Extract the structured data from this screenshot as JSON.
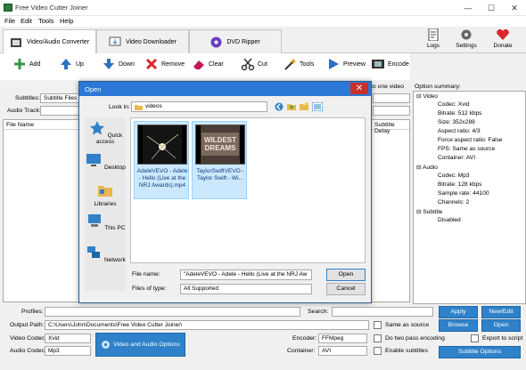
{
  "window": {
    "title": "Free Video Cutter Joiner",
    "minimize": "—",
    "maximize": "☐",
    "close": "✕"
  },
  "menu": [
    "File",
    "Edit",
    "Tools",
    "Help"
  ],
  "tabs": [
    {
      "label": "Video/Audio Converter",
      "active": true
    },
    {
      "label": "Video Downloader",
      "active": false
    },
    {
      "label": "DVD Ripper",
      "active": false
    }
  ],
  "top_buttons": [
    {
      "label": "Logs",
      "icon": "document-icon"
    },
    {
      "label": "Settings",
      "icon": "gear-icon"
    },
    {
      "label": "Donate",
      "icon": "heart-icon"
    }
  ],
  "toolbar": [
    {
      "label": "Add",
      "icon": "plus-icon"
    },
    {
      "label": "Up",
      "icon": "arrow-up-icon"
    },
    {
      "label": "Down",
      "icon": "arrow-down-icon"
    },
    {
      "label": "Remove",
      "icon": "x-icon"
    },
    {
      "label": "Clear",
      "icon": "eraser-icon"
    },
    {
      "label": "Cut",
      "icon": "scissors-icon"
    },
    {
      "label": "Tools",
      "icon": "wand-icon"
    },
    {
      "label": "Preview",
      "icon": "play-icon"
    },
    {
      "label": "Encode",
      "icon": "film-icon"
    }
  ],
  "merge_label": "to one video",
  "subtitles": {
    "label": "Subtitles:",
    "value": "Subtitle Files"
  },
  "audio_track": {
    "label": "Audio Track:"
  },
  "file_table": {
    "col_name": "File Name",
    "col_subtitle_delay": "Subtitle Delay"
  },
  "option_summary": {
    "title": "Option summary:",
    "video_header": "Video",
    "video": [
      "Codec: Xvid",
      "Bitrate: 512 kbps",
      "Size: 352x288",
      "Aspect ratio: 4/3",
      "Force aspect ratio: False",
      "FPS: Same as source",
      "Container: AVI"
    ],
    "audio_header": "Audio",
    "audio": [
      "Codec: Mp3",
      "Bitrate: 128 kbps",
      "Sample rate: 44100",
      "Channels: 2"
    ],
    "subtitle_header": "Subtitle",
    "subtitle": [
      "Disabled"
    ]
  },
  "bottom": {
    "profiles_label": "Profiles:",
    "search_label": "Search:",
    "output_path_label": "Output Path:",
    "output_path_value": "C:\\Users\\John\\Documents\\Free Video Cutter Joiner\\",
    "same_as_source": "Same as source",
    "video_codec_label": "Video Codec:",
    "video_codec_value": "Xvid",
    "audio_codec_label": "Audio Codec:",
    "audio_codec_value": "Mp3",
    "video_audio_options": "Video and Audio Options",
    "encoder_label": "Encoder:",
    "encoder_value": "FFMpeg",
    "container_label": "Container:",
    "container_value": "AVI",
    "two_pass": "Do two pass encoding",
    "enable_subtitles": "Enable subtitles",
    "apply": "Apply",
    "new_edit": "New/Edit",
    "browse": "Browse",
    "open": "Open",
    "export_to_script": "Export to script",
    "subtitle_options": "Subtitle Options"
  },
  "dialog": {
    "title": "Open",
    "look_in_label": "Look in:",
    "look_in_value": "videos",
    "places": [
      "Quick access",
      "Desktop",
      "Libraries",
      "This PC",
      "Network"
    ],
    "files": [
      {
        "caption": "AdeleVEVO - Adele - Hello (Live at the NRJ Awards).mp4",
        "selected": true
      },
      {
        "caption": "TaylorSwiftVEVO - Taylor Swift - Wi...",
        "selected": true
      }
    ],
    "thumb2_text": "WILDEST DREAMS",
    "file_name_label": "File name:",
    "file_name_value": "\"AdeleVEVO - Adele - Hello (Live at the NRJ Aw",
    "files_of_type_label": "Files of type:",
    "files_of_type_value": "All Supported",
    "open_button": "Open",
    "cancel_button": "Cancel"
  },
  "colors": {
    "accent": "#2f82c9",
    "dialog_title": "#2b78d6",
    "selection": "#cce8ff"
  }
}
